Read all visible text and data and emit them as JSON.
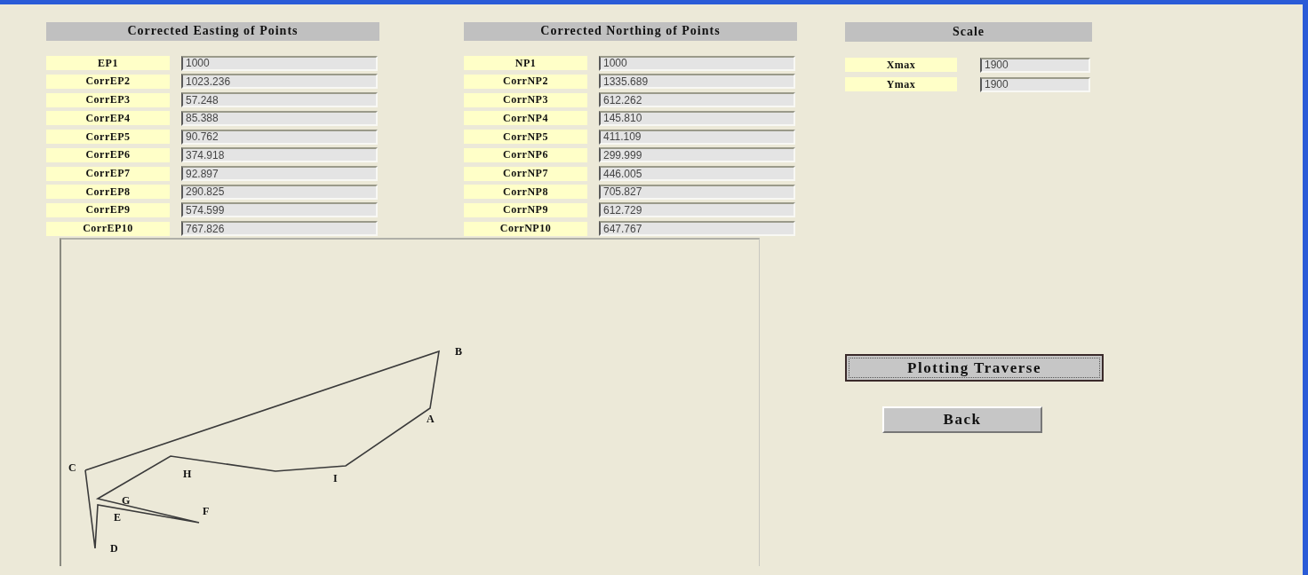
{
  "panels": [
    {
      "title": "Corrected Easting of Points",
      "rows": [
        {
          "label": "EP1",
          "value": "1000"
        },
        {
          "label": "CorrEP2",
          "value": "1023.236"
        },
        {
          "label": "CorrEP3",
          "value": "57.248"
        },
        {
          "label": "CorrEP4",
          "value": "85.388"
        },
        {
          "label": "CorrEP5",
          "value": "90.762"
        },
        {
          "label": "CorrEP6",
          "value": "374.918"
        },
        {
          "label": "CorrEP7",
          "value": "92.897"
        },
        {
          "label": "CorrEP8",
          "value": "290.825"
        },
        {
          "label": "CorrEP9",
          "value": "574.599"
        },
        {
          "label": "CorrEP10",
          "value": "767.826"
        }
      ]
    },
    {
      "title": "Corrected Northing of Points",
      "rows": [
        {
          "label": "NP1",
          "value": "1000"
        },
        {
          "label": "CorrNP2",
          "value": "1335.689"
        },
        {
          "label": "CorrNP3",
          "value": "612.262"
        },
        {
          "label": "CorrNP4",
          "value": "145.810"
        },
        {
          "label": "CorrNP5",
          "value": "411.109"
        },
        {
          "label": "CorrNP6",
          "value": "299.999"
        },
        {
          "label": "CorrNP7",
          "value": "446.005"
        },
        {
          "label": "CorrNP8",
          "value": "705.827"
        },
        {
          "label": "CorrNP9",
          "value": "612.729"
        },
        {
          "label": "CorrNP10",
          "value": "647.767"
        }
      ]
    },
    {
      "title": "Scale",
      "rows": [
        {
          "label": "Xmax",
          "value": "1900"
        },
        {
          "label": "Ymax",
          "value": "1900"
        }
      ]
    }
  ],
  "plot": {
    "point_labels": [
      "A",
      "B",
      "C",
      "D",
      "E",
      "F",
      "G",
      "H",
      "I"
    ]
  },
  "buttons": [
    {
      "label": "Plotting Traverse",
      "focused": true
    },
    {
      "label": "Back",
      "focused": false
    }
  ]
}
